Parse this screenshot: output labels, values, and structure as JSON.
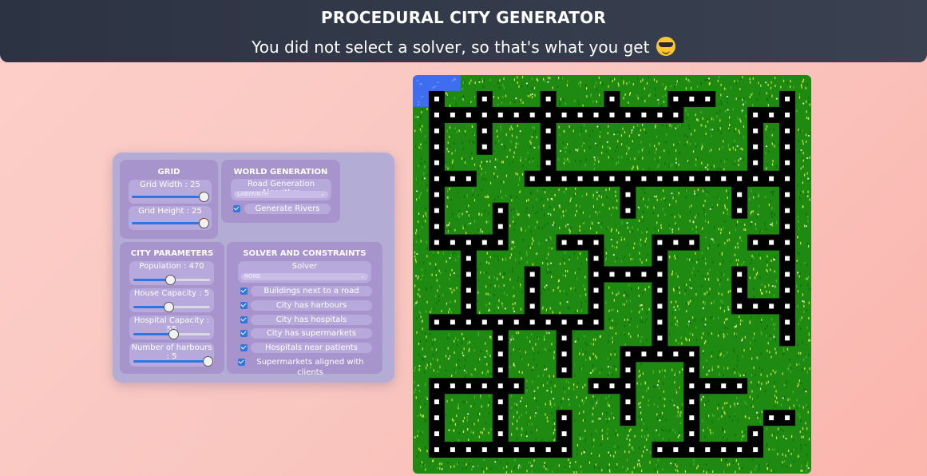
{
  "header": {
    "title": "PROCEDURAL CITY GENERATOR",
    "subtitle": "You did not select a solver, so that's what you get",
    "emoji_icon": "sunglasses-smiley-icon"
  },
  "grid": {
    "title": "GRID",
    "width_label": "Grid Width : 25",
    "width_value": 25,
    "height_label": "Grid Height : 25",
    "height_value": 25
  },
  "world": {
    "title": "WORLD GENERATION",
    "algorithm_label": "Road Generation Algorithm",
    "algorithm_value": "LABYRINTH",
    "rivers_label": "Generate Rivers",
    "rivers_checked": true
  },
  "city": {
    "title": "CITY PARAMETERS",
    "population_label": "Population : 470",
    "house_capacity_label": "House Capacity : 5",
    "hospital_capacity_label": "Hospital Capacity : 55",
    "harbours_label": "Number of harbours : 5"
  },
  "solver": {
    "title": "SOLVER AND CONSTRAINTS",
    "solver_label": "Solver",
    "solver_value": "NONE",
    "constraints": [
      {
        "label": "Buildings next to a road",
        "checked": true
      },
      {
        "label": "City has harbours",
        "checked": true
      },
      {
        "label": "City has hospitals",
        "checked": true
      },
      {
        "label": "City has supermarkets",
        "checked": true
      },
      {
        "label": "Hospitals near patients",
        "checked": true
      },
      {
        "label": "Supermarkets aligned with clients",
        "checked": true
      }
    ]
  },
  "map": {
    "colors": {
      "grass": "#1f8a12",
      "road": "#000000",
      "water": "#3f6df0",
      "marker": "#ffffff"
    },
    "tiles": [
      "WWWGGGGGGGGGGGGGGGGGGGGGG",
      "WRGGRGGGRGGGRGGGRRRGGGGRG",
      "GRRRRRRRRRRRRRRRRGGGGRRRG",
      "GRGGRGGGRGGGGGGGGGGGGRGRG",
      "GRGGRGGGRGGGGGGGGGGGGRGRG",
      "GRGGGGGGRGGGGGGGGGGGGRGRG",
      "GRRRGGGRRRRRRRRRRRRRRRRRG",
      "GRGGGGGGGGGGGRGGGGGGRGGRG",
      "GRGGGRGGGGGGGRGGGGGGRGGRG",
      "GRGGGRGGGGGGGGGGGGGGGGGRG",
      "GRRRRRGGGRRRGGGRRRGGGRRRG",
      "GGGRGGGGGGGRGGGRGGGGGGGRG",
      "GGGRGGGRGGGRRRRRGGGGRGGRG",
      "GGGRGGGRGGGRGGGRGGGGRGGRG",
      "GGGRGGGRGGGRGGGRGGGGRRRRG",
      "GRRRRRRRRRRRGGGRGGGGGGGRG",
      "GGGGGRGGGRGGGGGRGGGGGGGRG",
      "GGGGGRGGGRGGGRRRRRGGGGGGG",
      "GGGGGRGGGRGGGRGGGRGGGGGGG",
      "GRRRRRRGGGGRRRGGGRRRRGGGG",
      "GRGGGRGGGGGGGRGGGRGGGGGGG",
      "GRGGGRGGGRGGGRGGGRGGGGRRG",
      "GRGGGRGGGRGGGGGGGRGGGRGGG",
      "GRRRRRRRRRGGGGGRRRRRRRGGG",
      "GGGGGGGGGGGGGGGGGGGGGGGGG"
    ]
  }
}
